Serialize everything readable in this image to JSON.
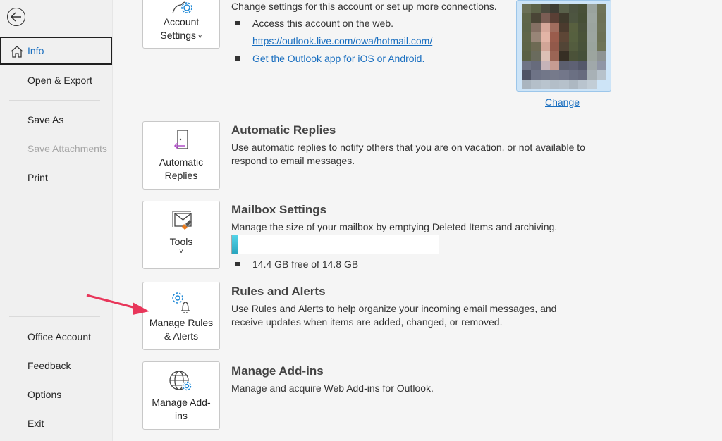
{
  "sidebar": {
    "back_label": "Back",
    "items": [
      {
        "label": "Info",
        "active": true
      },
      {
        "label": "Open & Export"
      },
      {
        "label": "Save As"
      },
      {
        "label": "Save Attachments",
        "disabled": true
      },
      {
        "label": "Print"
      },
      {
        "label": "Office Account"
      },
      {
        "label": "Feedback"
      },
      {
        "label": "Options"
      },
      {
        "label": "Exit"
      }
    ]
  },
  "account": {
    "tile_label": "Account Settings",
    "description": "Change settings for this account or set up more connections.",
    "bullet1": "Access this account on the web.",
    "web_link": "https://outlook.live.com/owa/hotmail.com/",
    "app_link": "Get the Outlook app for iOS or Android.",
    "change_photo": "Change"
  },
  "auto_replies": {
    "tile_label": "Automatic Replies",
    "title": "Automatic Replies",
    "description": "Use automatic replies to notify others that you are on vacation, or not available to respond to email messages."
  },
  "mailbox": {
    "tile_label": "Tools",
    "title": "Mailbox Settings",
    "description": "Manage the size of your mailbox by emptying Deleted Items and archiving.",
    "usage_fraction": 0.027,
    "usage_text": "14.4 GB free of 14.8 GB"
  },
  "rules": {
    "tile_label": "Manage Rules & Alerts",
    "title": "Rules and Alerts",
    "description": "Use Rules and Alerts to help organize your incoming email messages, and receive updates when items are added, changed, or removed."
  },
  "addins": {
    "tile_label": "Manage Add-ins",
    "title": "Manage Add-ins",
    "description": "Manage and acquire Web Add-ins for Outlook."
  },
  "colors": {
    "accent": "#1a6fc0",
    "annotation_arrow": "#e8365a",
    "progress": "#2fb3cc"
  }
}
